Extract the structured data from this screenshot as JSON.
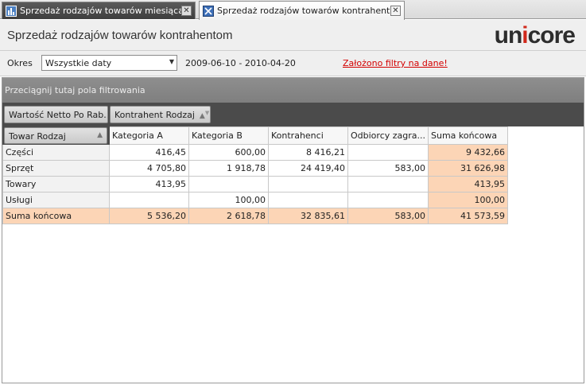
{
  "tabs": [
    {
      "label": "Sprzedaż rodzajów towarów miesiącami",
      "close": "✕"
    },
    {
      "label": "Sprzedaż rodzajów towarów kontrahentom",
      "close": "✕"
    }
  ],
  "header": {
    "title": "Sprzedaż rodzajów towarów kontrahentom",
    "logo": {
      "un": "un",
      "i": "i",
      "core": "core"
    }
  },
  "filters": {
    "okres_label": "Okres",
    "okres_value": "Wszystkie daty",
    "date_range": "2009-06-10 - 2010-04-20",
    "applied_link": "Założono filtry na dane!"
  },
  "pivot": {
    "filter_area_hint": "Przeciągnij tutaj pola filtrowania",
    "data_field": "Wartość Netto Po Rab...",
    "column_field": "Kontrahent Rodzaj",
    "row_field": "Towar Rodzaj",
    "columns": [
      "Kategoria A",
      "Kategoria B",
      "Kontrahenci",
      "Odbiorcy zagra...",
      "Suma końcowa"
    ],
    "rows": [
      {
        "label": "Części",
        "values": [
          "416,45",
          "600,00",
          "8 416,21",
          "",
          "9 432,66"
        ]
      },
      {
        "label": "Sprzęt",
        "values": [
          "4 705,80",
          "1 918,78",
          "24 419,40",
          "583,00",
          "31 626,98"
        ]
      },
      {
        "label": "Towary",
        "values": [
          "413,95",
          "",
          "",
          "",
          "413,95"
        ]
      },
      {
        "label": "Usługi",
        "values": [
          "",
          "100,00",
          "",
          "",
          "100,00"
        ]
      }
    ],
    "total_row": {
      "label": "Suma końcowa",
      "values": [
        "5 536,20",
        "2 618,78",
        "32 835,61",
        "583,00",
        "41 573,59"
      ]
    }
  },
  "colors": {
    "accent": "#d0281b",
    "total_bg": "#fcd5b6",
    "link": "#d40000"
  }
}
